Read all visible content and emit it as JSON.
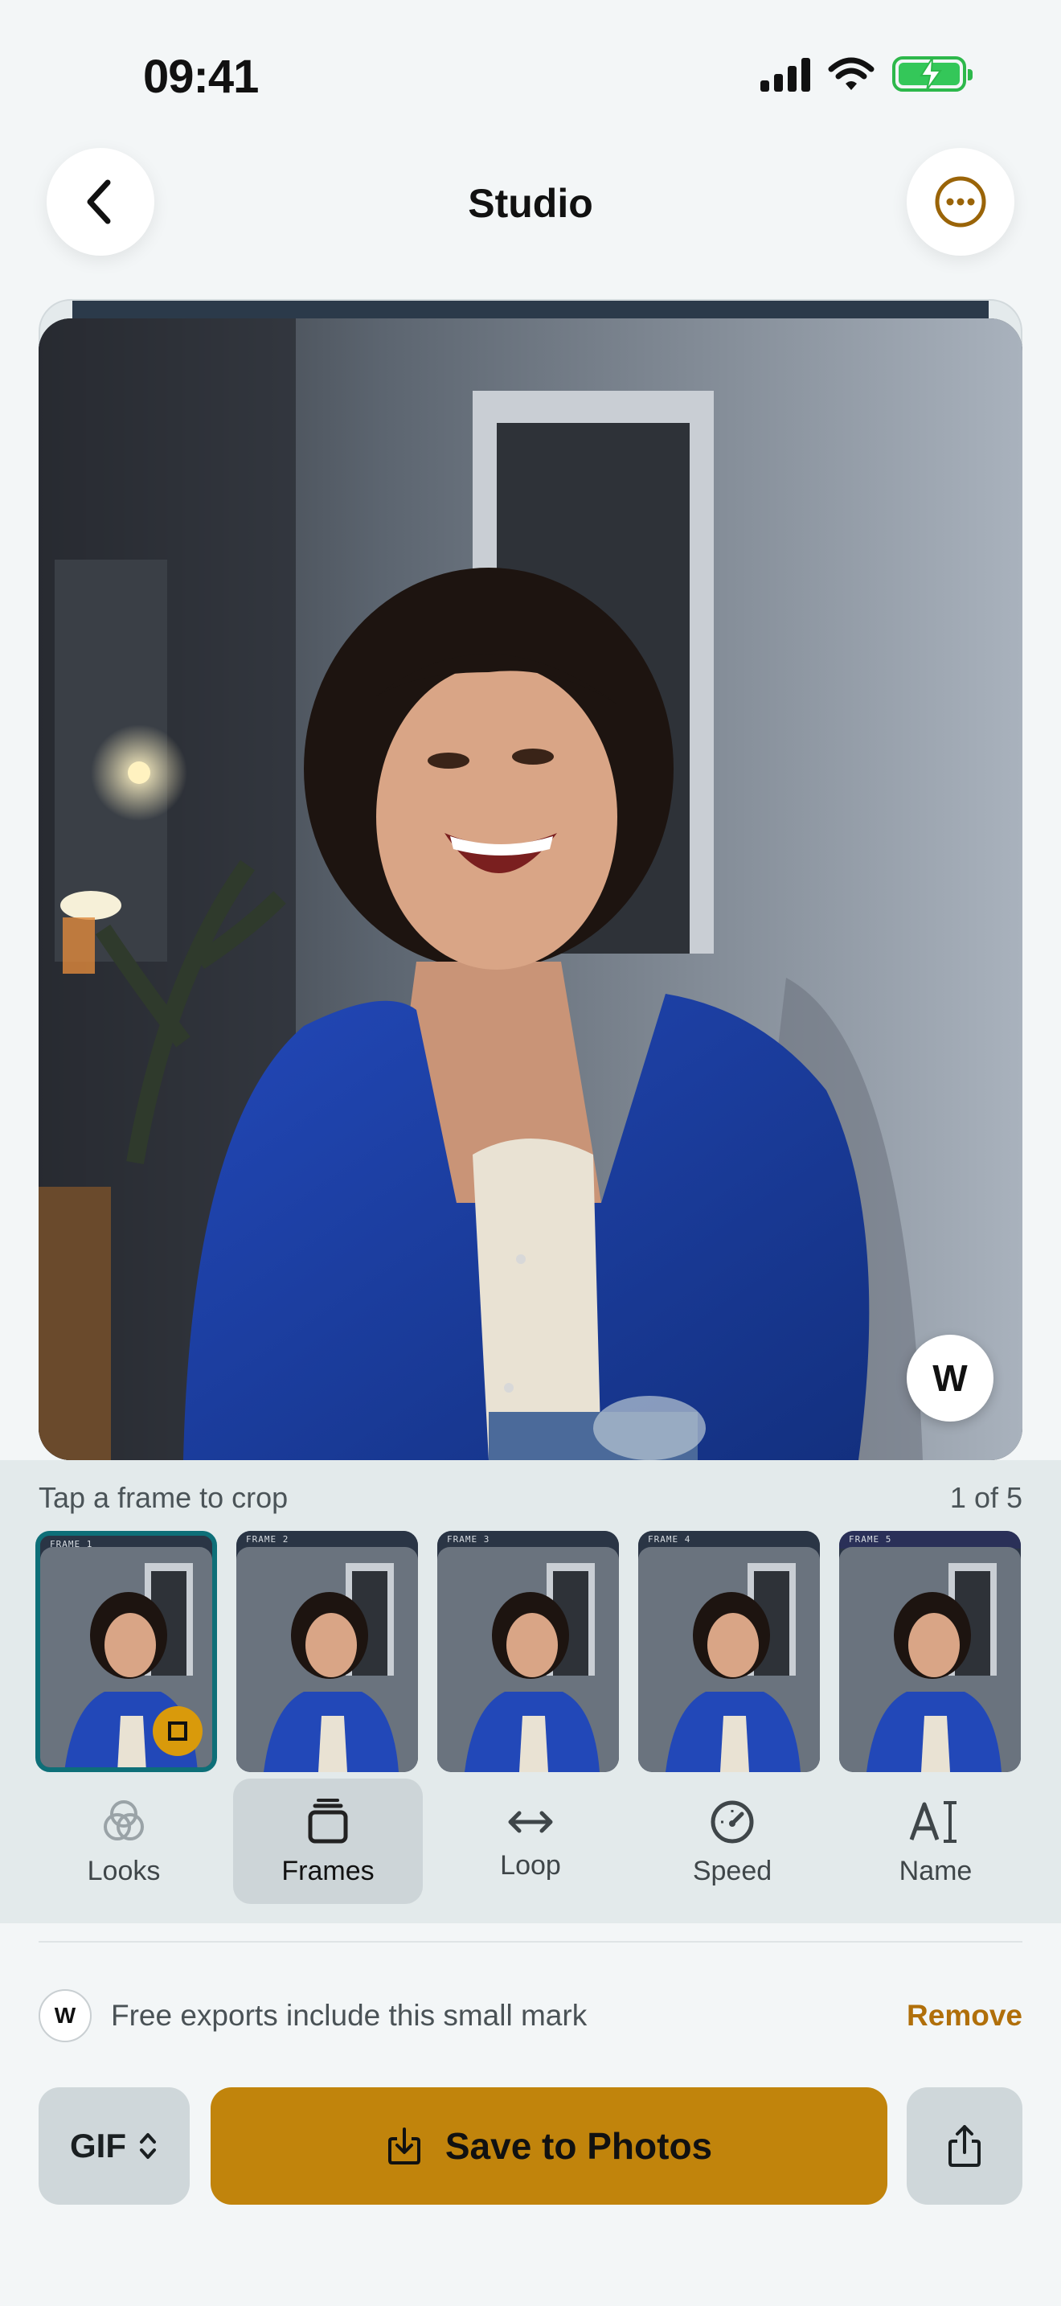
{
  "status_bar": {
    "time": "09:41"
  },
  "header": {
    "title": "Studio",
    "back_icon": "chevron-left-icon",
    "more_icon": "ellipsis-circle-icon"
  },
  "photo": {
    "description_icon": "photo",
    "watermark_badge": "W"
  },
  "editor": {
    "crop_hint": "Tap a frame to crop",
    "frame_count": "1 of 5",
    "frames": [
      {
        "label": "FRAME 1",
        "selected": true
      },
      {
        "label": "FRAME 2",
        "selected": false
      },
      {
        "label": "FRAME 3",
        "selected": false
      },
      {
        "label": "FRAME 4",
        "selected": false
      },
      {
        "label": "FRAME 5",
        "selected": false
      }
    ],
    "tools": [
      {
        "label": "Looks",
        "icon": "looks-icon",
        "active": false
      },
      {
        "label": "Frames",
        "icon": "frames-icon",
        "active": true
      },
      {
        "label": "Loop",
        "icon": "loop-arrows-icon",
        "active": false
      },
      {
        "label": "Speed",
        "icon": "speedometer-icon",
        "active": false
      },
      {
        "label": "Name",
        "icon": "text-cursor-icon",
        "active": false
      }
    ]
  },
  "watermark_notice": {
    "badge": "W",
    "text": "Free exports include this small mark",
    "remove_label": "Remove"
  },
  "actions": {
    "format": "GIF",
    "save_label": "Save to Photos",
    "share_icon": "share-icon"
  },
  "colors": {
    "accent": "#c1840c",
    "accent_text": "#b06f0a",
    "selected_frame": "#0e6f78",
    "panel_bg": "#e3eaeb",
    "page_bg": "#f3f6f7"
  }
}
